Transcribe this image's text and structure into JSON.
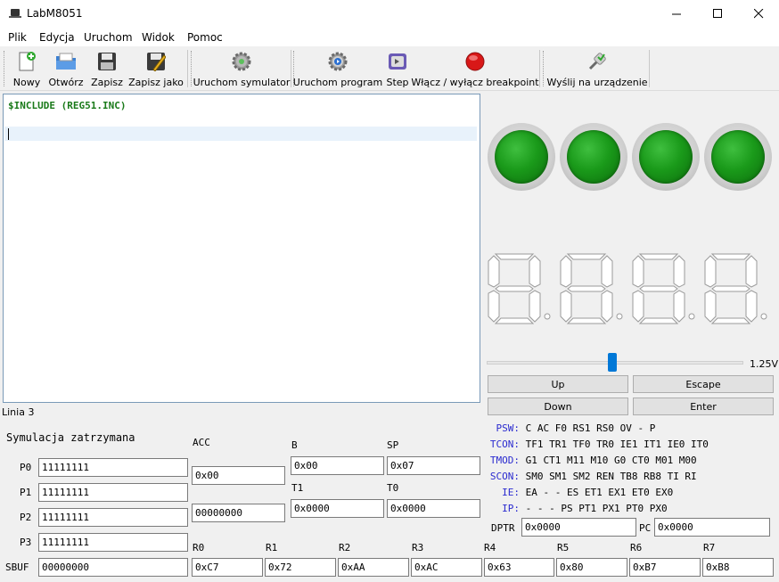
{
  "window": {
    "title": "LabM8051"
  },
  "menu": [
    "Plik",
    "Edycja",
    "Uruchom",
    "Widok",
    "Pomoc"
  ],
  "toolbar": {
    "new": "Nowy",
    "open": "Otwórz",
    "save": "Zapisz",
    "save_as": "Zapisz jako",
    "run_sim": "Uruchom symulator",
    "run_prog": "Uruchom program",
    "step": "Step",
    "breakpoint": "Włącz / wyłącz breakpoint",
    "send": "Wyślij na urządzenie"
  },
  "editor": {
    "line1": "$INCLUDE (REG51.INC)",
    "status": "Linia 3"
  },
  "panel": {
    "slider_value": "1.25V",
    "slider_level": 0.49,
    "up": "Up",
    "escape": "Escape",
    "down": "Down",
    "enter": "Enter"
  },
  "sim": {
    "status": "Symulacja zatrzymana",
    "p0_label": "P0",
    "p0": "11111111",
    "p1_label": "P1",
    "p1": "11111111",
    "p2_label": "P2",
    "p2": "11111111",
    "p3_label": "P3",
    "p3": "11111111",
    "sbuf_label": "SBUF",
    "sbuf": "00000000",
    "acc_label": "ACC",
    "acc_hex": "0x00",
    "acc_bin": "00000000",
    "b_label": "B",
    "b": "0x00",
    "sp_label": "SP",
    "sp": "0x07",
    "t1_label": "T1",
    "t1": "0x0000",
    "t0_label": "T0",
    "t0": "0x0000",
    "dptr_label": "DPTR",
    "dptr": "0x0000",
    "pc_label": "PC",
    "pc": "0x0000",
    "regs": [
      {
        "name": "R0",
        "value": "0xC7"
      },
      {
        "name": "R1",
        "value": "0x72"
      },
      {
        "name": "R2",
        "value": "0xAA"
      },
      {
        "name": "R3",
        "value": "0xAC"
      },
      {
        "name": "R4",
        "value": "0x63"
      },
      {
        "name": "R5",
        "value": "0x80"
      },
      {
        "name": "R6",
        "value": "0xB7"
      },
      {
        "name": "R7",
        "value": "0xB8"
      }
    ],
    "sfr": [
      {
        "name": "PSW:",
        "bits": "C AC F0 RS1 RS0 OV - P"
      },
      {
        "name": "TCON:",
        "bits": "TF1 TR1 TF0 TR0 IE1 IT1 IE0 IT0"
      },
      {
        "name": "TMOD:",
        "bits": "G1 CT1 M11 M10 G0 CT0 M01 M00"
      },
      {
        "name": "SCON:",
        "bits": "SM0 SM1 SM2 REN TB8 RB8 TI RI"
      },
      {
        "name": "IE:",
        "bits": "EA - - ES ET1 EX1 ET0 EX0"
      },
      {
        "name": "IP:",
        "bits": "- - - PS PT1 PX1 PT0 PX0"
      }
    ]
  },
  "colors": {
    "accent": "#0078d7",
    "led_on": "#1a9a1a",
    "reg_label": "#2a2acf",
    "code": "#1a7a1a"
  }
}
